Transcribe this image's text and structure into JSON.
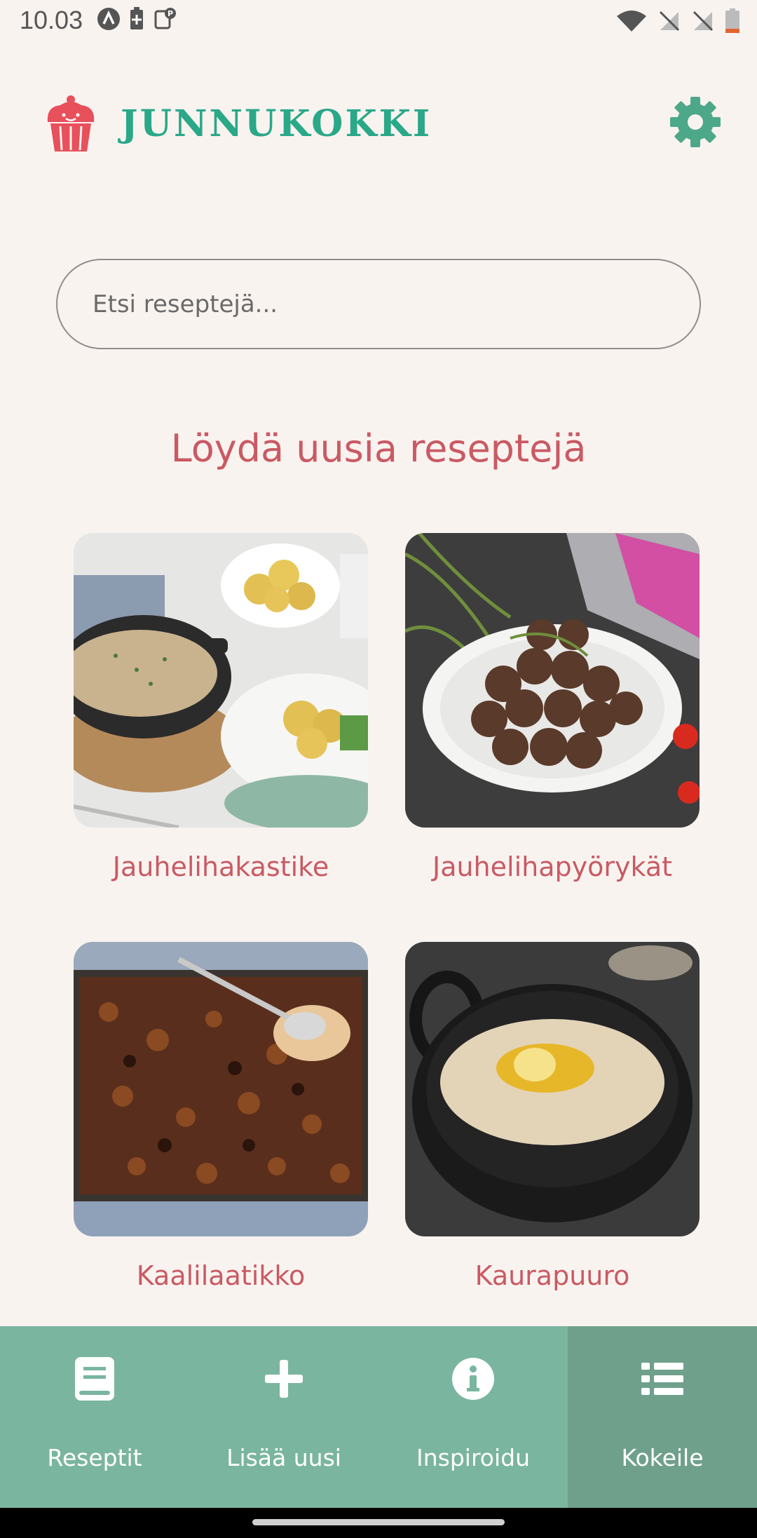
{
  "status_bar": {
    "time": "10.03",
    "left_icons": [
      "app-a-icon",
      "battery-saver-icon",
      "parking-icon"
    ],
    "right_icons": [
      "wifi-icon",
      "signal-off-icon",
      "signal-off-icon",
      "battery-low-icon"
    ]
  },
  "header": {
    "app_name": "JUNNUKOKKI",
    "logo_icon": "cupcake-icon",
    "settings_icon": "gear-icon"
  },
  "search": {
    "placeholder": "Etsi reseptejä..."
  },
  "section": {
    "title": "Löydä uusia reseptejä"
  },
  "recipes": [
    {
      "name": "Jauhelihakastike"
    },
    {
      "name": "Jauhelihapyörykät"
    },
    {
      "name": "Kaalilaatikko"
    },
    {
      "name": "Kaurapuuro"
    }
  ],
  "bottom_nav": {
    "items": [
      {
        "label": "Reseptit",
        "icon": "book-icon"
      },
      {
        "label": "Lisää uusi",
        "icon": "plus-icon"
      },
      {
        "label": "Inspiroidu",
        "icon": "info-icon"
      },
      {
        "label": "Kokeile",
        "icon": "list-icon"
      }
    ],
    "active_index": 3
  },
  "colors": {
    "accent_green": "#2aa888",
    "title_red": "#c95a63",
    "nav_bg": "#7ab59f",
    "nav_active_bg": "#6fa08c",
    "background": "#f9f3f0"
  }
}
